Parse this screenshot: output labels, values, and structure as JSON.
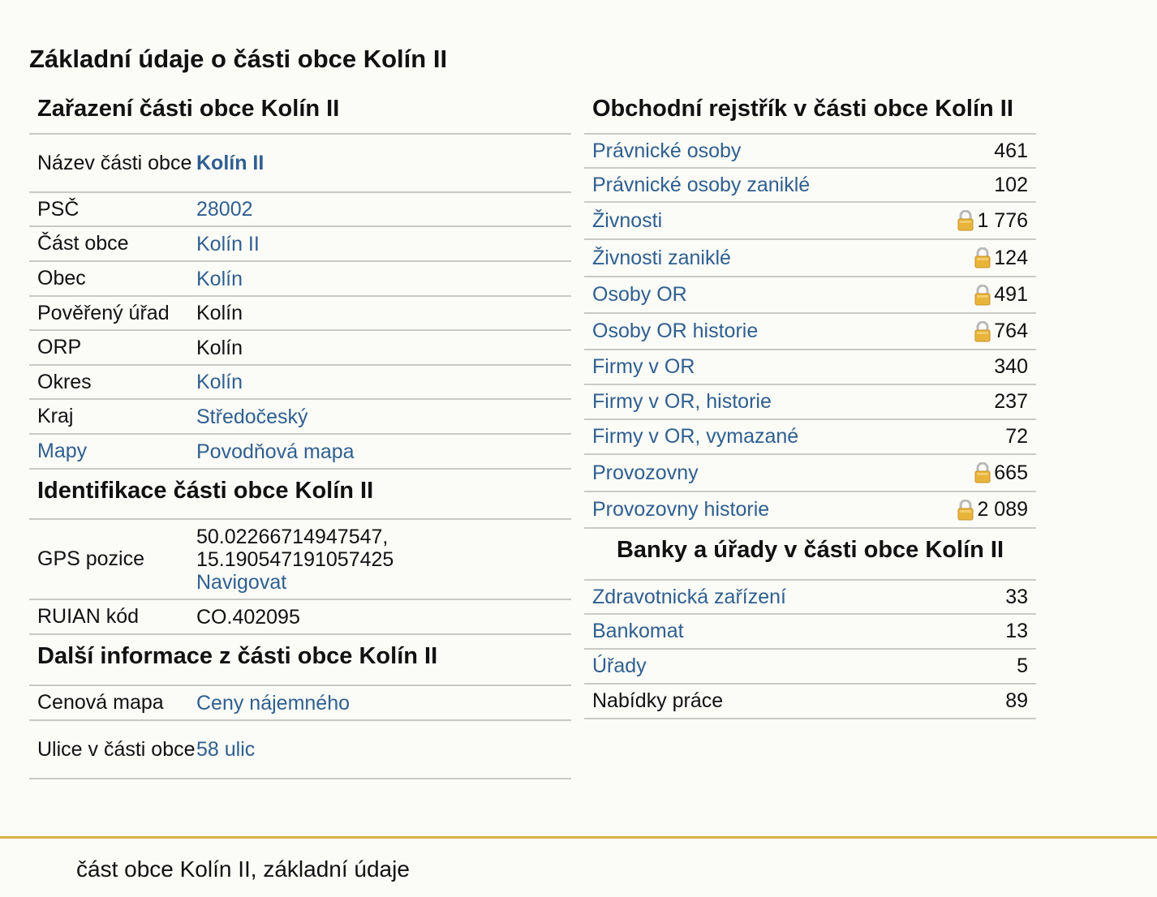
{
  "page_title": "Základní údaje o části obce Kolín II",
  "zarazeni": {
    "title": "Zařazení části obce Kolín II",
    "rows": [
      {
        "label": "Název části obce",
        "value": "Kolín II"
      },
      {
        "label": "PSČ",
        "value": "28002"
      },
      {
        "label": "Část obce",
        "value": "Kolín II"
      },
      {
        "label": "Obec",
        "value": "Kolín"
      },
      {
        "label": "Pověřený úřad",
        "value": "Kolín"
      },
      {
        "label": "ORP",
        "value": "Kolín"
      },
      {
        "label": "Okres",
        "value": "Kolín"
      },
      {
        "label": "Kraj",
        "value": "Středočeský"
      },
      {
        "label": "Mapy",
        "value": "Povodňová mapa"
      }
    ]
  },
  "identifikace": {
    "title": "Identifikace části obce Kolín II",
    "gps_label": "GPS pozice",
    "gps_lat": "50.02266714947547,",
    "gps_lon": "15.190547191057425",
    "navigate": "Navigovat",
    "ruian_label": "RUIAN kód",
    "ruian_value": "CO.402095"
  },
  "dalsi": {
    "title": "Další informace z části obce Kolín II",
    "rows": [
      {
        "label": "Cenová mapa",
        "value": "Ceny nájemného"
      },
      {
        "label": "Ulice v části obce",
        "value": "58 ulic"
      }
    ]
  },
  "obchodni": {
    "title": "Obchodní rejstřík v části obce Kolín II",
    "rows": [
      {
        "label": "Právnické osoby",
        "value": "461",
        "locked": false
      },
      {
        "label": "Právnické osoby zaniklé",
        "value": "102",
        "locked": false
      },
      {
        "label": "Živnosti",
        "value": "1 776",
        "locked": true
      },
      {
        "label": "Živnosti zaniklé",
        "value": "124",
        "locked": true
      },
      {
        "label": "Osoby OR",
        "value": "491",
        "locked": true
      },
      {
        "label": "Osoby OR historie",
        "value": "764",
        "locked": true
      },
      {
        "label": "Firmy v OR",
        "value": "340",
        "locked": false
      },
      {
        "label": "Firmy v OR, historie",
        "value": "237",
        "locked": false
      },
      {
        "label": "Firmy v OR, vymazané",
        "value": "72",
        "locked": false
      },
      {
        "label": "Provozovny",
        "value": "665",
        "locked": true
      },
      {
        "label": "Provozovny historie",
        "value": "2 089",
        "locked": true
      }
    ]
  },
  "banky": {
    "title": "Banky a úřady v části obce Kolín II",
    "rows": [
      {
        "label": "Zdravotnická zařízení",
        "value": "33"
      },
      {
        "label": "Bankomat",
        "value": "13"
      },
      {
        "label": "Úřady",
        "value": "5"
      },
      {
        "label": "Nabídky práce",
        "value": "89"
      }
    ]
  },
  "footer": "část obce Kolín II, základní údaje",
  "colors": {
    "link": "#2f5f8f",
    "accent_line": "#d6b245",
    "lock": "#e8b43a"
  }
}
